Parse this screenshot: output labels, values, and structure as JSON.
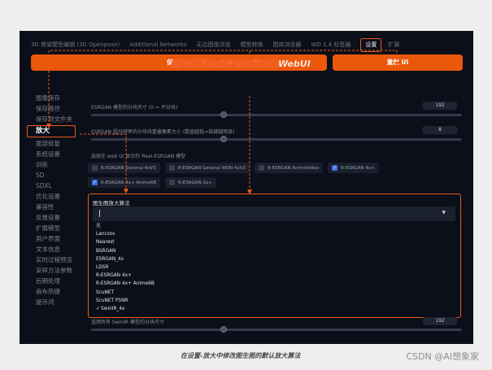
{
  "tabs": [
    "3D 骨架模型编辑 (3D Openpose)",
    "Additional Networks",
    "无边图像浏览",
    "模型转换",
    "图库浏览器",
    "WD 1.4 标签器",
    "设置",
    "扩展"
  ],
  "active_tab": "设置",
  "buttons": {
    "save": "保存设置",
    "reload": "重载 UI"
  },
  "sidebar": {
    "items": [
      "图像保存",
      "保存路径",
      "保存到文件夹",
      "放大",
      "面部修复",
      "系统设置",
      "训练",
      "SD",
      "SDXL",
      "优化设置",
      "兼容性",
      "反推设置",
      "扩展模型",
      "用户界面",
      "文本信息",
      "实时过程预览",
      "采样方法参数",
      "后期处理",
      "画布热键",
      "提示词"
    ],
    "active": "放大"
  },
  "callout": "选择算法后点击保存并重载WebUI",
  "settings": {
    "tile_label": "ESRGAN 模型的分块尺寸 (0 = 不分块)",
    "tile_value": "192",
    "overlap_label": "ESRGAN 超分辨率的分块块重叠像素大小 (数值越低=接缝越明显)",
    "overlap_value": "8",
    "realesrgan_label": "选择在 web UI 显示的 Real-ESRGAN 模型",
    "realesrgan_models": [
      {
        "name": "R-ESRGAN General 4xV3",
        "checked": false
      },
      {
        "name": "R-ESRGAN General WDN 4xV3",
        "checked": false
      },
      {
        "name": "R-ESRGAN AnimeVideo",
        "checked": false
      },
      {
        "name": "R-ESRGAN 4x+",
        "checked": true
      },
      {
        "name": "R-ESRGAN 4x+ Anime6B",
        "checked": true
      },
      {
        "name": "R-ESRGAN 2x+",
        "checked": false
      }
    ]
  },
  "dropdown": {
    "title": "图生图放大算法",
    "options": [
      "无",
      "Lanczos",
      "Nearest",
      "BSRGAN",
      "ESRGAN_4x",
      "LDSR",
      "R-ESRGAN 4x+",
      "R-ESRGAN 4x+ Anime6B",
      "ScuNET",
      "ScuNET PSNR",
      "SwinIR_4x"
    ],
    "selected": "SwinIR_4x"
  },
  "below": {
    "label": "适用所有 SwinIR 模型的分块尺寸",
    "value": "192"
  },
  "caption": "在设置-放大中修改图生图的默认放大算法",
  "watermark": "CSDN @AI想象家",
  "colors": {
    "accent": "#ea580c",
    "background": "#0b0f19",
    "annotation": "#f05a1a"
  }
}
